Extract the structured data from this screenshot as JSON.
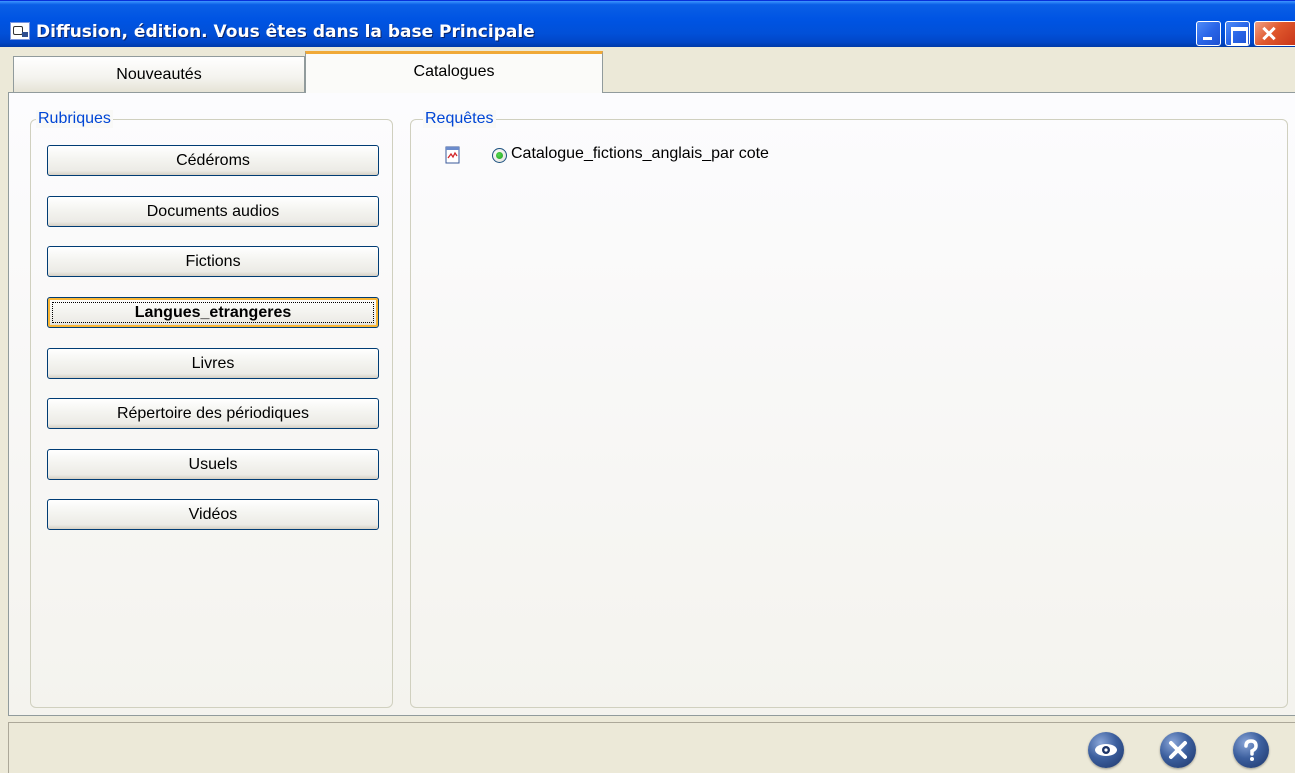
{
  "window": {
    "title": "Diffusion, édition.  Vous êtes dans la base Principale"
  },
  "tabs": [
    {
      "label": "Nouveautés",
      "selected": false
    },
    {
      "label": "Catalogues",
      "selected": true
    }
  ],
  "rubriques": {
    "legend": "Rubriques",
    "items": [
      {
        "label": "Cédéroms"
      },
      {
        "label": "Documents audios"
      },
      {
        "label": "Fictions"
      },
      {
        "label": "Langues_etrangeres",
        "active": true
      },
      {
        "label": "Livres"
      },
      {
        "label": "Répertoire des périodiques"
      },
      {
        "label": "Usuels"
      },
      {
        "label": "Vidéos"
      }
    ]
  },
  "requetes": {
    "legend": "Requêtes",
    "items": [
      {
        "label": "Catalogue_fictions_anglais_par cote",
        "selected": true,
        "icon": "report-icon"
      }
    ]
  },
  "statusbar": {
    "buttons": [
      "eye-icon",
      "cancel-icon",
      "help-icon"
    ]
  },
  "colors": {
    "titlebar": "#0054e3",
    "legend": "#0046d5",
    "tab_active_accent": "#f0a938"
  }
}
